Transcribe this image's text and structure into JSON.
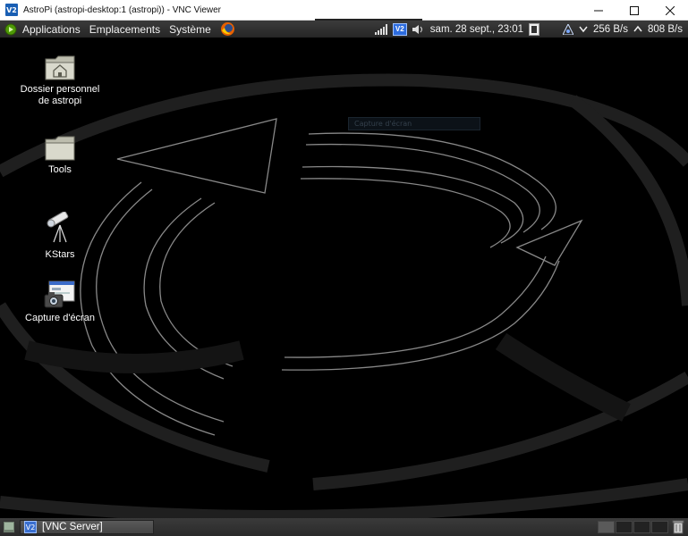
{
  "window": {
    "badge": "V2",
    "title": "AstroPi (astropi-desktop:1 (astropi)) - VNC Viewer"
  },
  "top_panel": {
    "menus": [
      "Applications",
      "Emplacements",
      "Système"
    ],
    "clock": "sam. 28 sept., 23:01",
    "vnc_badge": "V2",
    "download_rate": "256 B/s",
    "upload_rate": "808 B/s"
  },
  "desktop": {
    "icons": [
      {
        "label": "Dossier personnel de astropi",
        "icon": "home-folder-icon"
      },
      {
        "label": "Tools",
        "icon": "folder-icon"
      },
      {
        "label": "KStars",
        "icon": "telescope-icon"
      },
      {
        "label": "Capture d'écran",
        "icon": "screenshot-icon"
      }
    ],
    "ghost_window_label": "Capture d'écran"
  },
  "bottom_panel": {
    "task_label": "[VNC Server]",
    "workspace_count": 4,
    "active_workspace": 1
  },
  "colors": {
    "panel": "#2f2f2f",
    "desktop": "#000000",
    "accent": "#1a5fb4"
  }
}
